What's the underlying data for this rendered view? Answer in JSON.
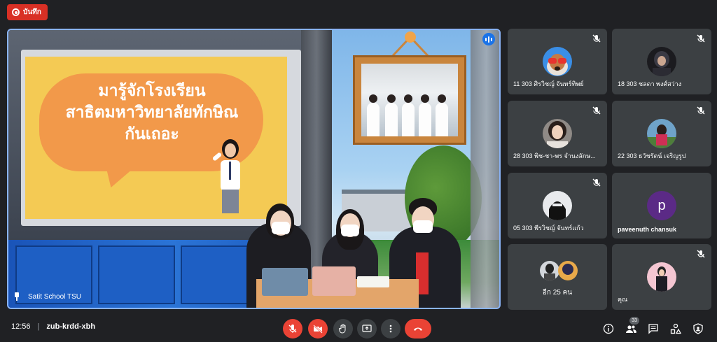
{
  "recording": {
    "label": "บันทึก",
    "color": "#d93025"
  },
  "main_stage": {
    "presenter_name": "Satit School TSU",
    "slide_text_lines": [
      "มารู้จักโรงเรียน",
      "สาธิตมหาวิทยาลัยทักษิณ",
      "กันเถอะ"
    ],
    "active_speaker_color": "#8ab4f8"
  },
  "participants": [
    {
      "name": "11 303 ศิรวิชญ์ จันทร์ทิพย์",
      "muted": true,
      "avatar": "dog-with-sunglasses"
    },
    {
      "name": "18 303 ชลดา พงศ์สว่าง",
      "muted": true,
      "avatar": "dark-character"
    },
    {
      "name": "28 303 พิช-ชา-พร จำนงลักษ...",
      "muted": true,
      "avatar": "girl-photo"
    },
    {
      "name": "22 303 ธวัชรัตน์ เจริญรูป",
      "muted": true,
      "avatar": "girl-outdoor-photo"
    },
    {
      "name": "05 303 พีรวิชญ์ จันทร์แก้ว",
      "muted": true,
      "avatar": "masked-figure"
    },
    {
      "name": "paveenuth chansuk",
      "muted": false,
      "avatar": "letter",
      "letter": "p",
      "avatar_color": "#5b2a86"
    },
    {
      "name": "อีก 25 คน",
      "muted": false,
      "avatar": "group"
    },
    {
      "name": "คุณ",
      "muted": true,
      "avatar": "self-photo"
    }
  ],
  "meeting": {
    "time": "12:56",
    "separator": "|",
    "code": "zub-krdd-xbh",
    "participant_count": "33"
  },
  "controls": {
    "mic": "mic-off-icon",
    "camera": "camera-off-icon",
    "raise_hand": "hand-icon",
    "present": "present-screen-icon",
    "more": "more-options-icon",
    "hangup": "hangup-icon"
  },
  "side_controls": [
    "info-icon",
    "people-icon",
    "chat-icon",
    "activities-icon",
    "host-controls-icon"
  ],
  "colors": {
    "background": "#202124",
    "tile": "#3c4043",
    "danger": "#ea4335",
    "accent": "#1a73e8"
  }
}
